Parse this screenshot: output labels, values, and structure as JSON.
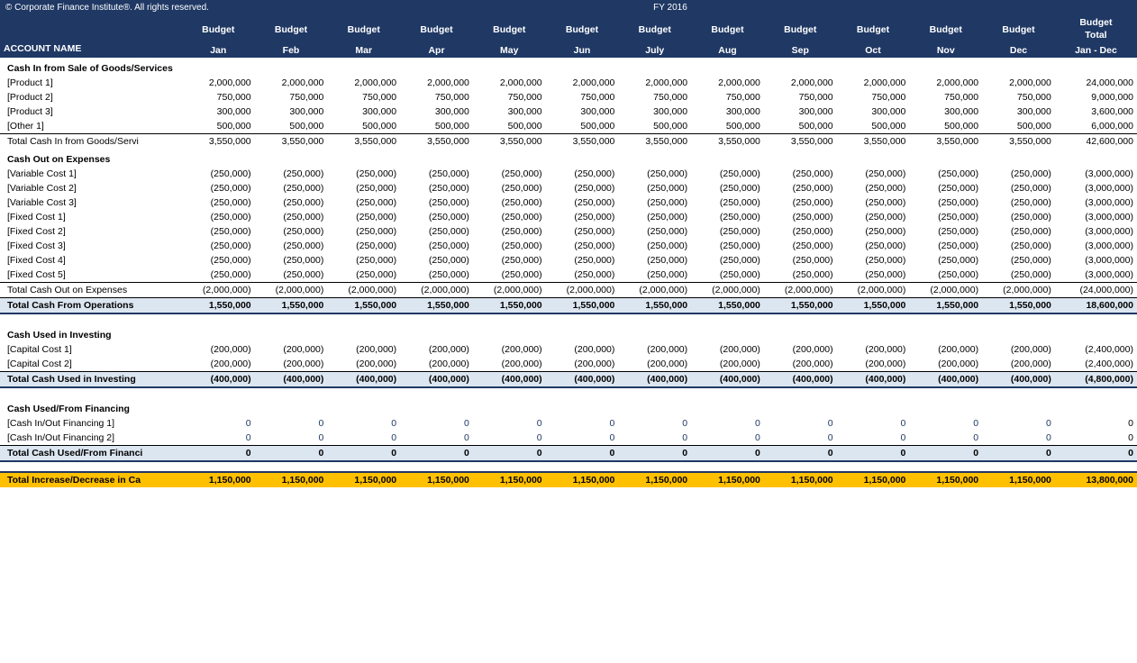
{
  "topBar": {
    "copyright": "© Corporate Finance Institute®. All rights reserved."
  },
  "fyHeader": "FY 2016",
  "columns": {
    "account": "ACCOUNT NAME",
    "months": [
      "Jan",
      "Feb",
      "Mar",
      "Apr",
      "May",
      "Jun",
      "July",
      "Aug",
      "Sep",
      "Oct",
      "Nov",
      "Dec"
    ],
    "budgetLabel": "Budget",
    "totalLabel": "Budget\nTotal",
    "totalSub": "Jan - Dec"
  },
  "sections": {
    "cashIn": {
      "header": "Cash In from Sale of Goods/Services",
      "rows": [
        {
          "name": "[Product 1]",
          "values": [
            "2,000,000",
            "2,000,000",
            "2,000,000",
            "2,000,000",
            "2,000,000",
            "2,000,000",
            "2,000,000",
            "2,000,000",
            "2,000,000",
            "2,000,000",
            "2,000,000",
            "2,000,000"
          ],
          "total": "24,000,000"
        },
        {
          "name": "[Product 2]",
          "values": [
            "750,000",
            "750,000",
            "750,000",
            "750,000",
            "750,000",
            "750,000",
            "750,000",
            "750,000",
            "750,000",
            "750,000",
            "750,000",
            "750,000"
          ],
          "total": "9,000,000"
        },
        {
          "name": "[Product 3]",
          "values": [
            "300,000",
            "300,000",
            "300,000",
            "300,000",
            "300,000",
            "300,000",
            "300,000",
            "300,000",
            "300,000",
            "300,000",
            "300,000",
            "300,000"
          ],
          "total": "3,600,000"
        },
        {
          "name": "[Other 1]",
          "values": [
            "500,000",
            "500,000",
            "500,000",
            "500,000",
            "500,000",
            "500,000",
            "500,000",
            "500,000",
            "500,000",
            "500,000",
            "500,000",
            "500,000"
          ],
          "total": "6,000,000"
        }
      ],
      "subtotal": {
        "name": "Total Cash In from Goods/Servi",
        "values": [
          "3,550,000",
          "3,550,000",
          "3,550,000",
          "3,550,000",
          "3,550,000",
          "3,550,000",
          "3,550,000",
          "3,550,000",
          "3,550,000",
          "3,550,000",
          "3,550,000",
          "3,550,000"
        ],
        "total": "42,600,000"
      }
    },
    "cashOut": {
      "header": "Cash Out on Expenses",
      "rows": [
        {
          "name": "[Variable Cost 1]",
          "values": [
            "(250,000)",
            "(250,000)",
            "(250,000)",
            "(250,000)",
            "(250,000)",
            "(250,000)",
            "(250,000)",
            "(250,000)",
            "(250,000)",
            "(250,000)",
            "(250,000)",
            "(250,000)"
          ],
          "total": "(3,000,000)"
        },
        {
          "name": "[Variable Cost 2]",
          "values": [
            "(250,000)",
            "(250,000)",
            "(250,000)",
            "(250,000)",
            "(250,000)",
            "(250,000)",
            "(250,000)",
            "(250,000)",
            "(250,000)",
            "(250,000)",
            "(250,000)",
            "(250,000)"
          ],
          "total": "(3,000,000)"
        },
        {
          "name": "[Variable Cost 3]",
          "values": [
            "(250,000)",
            "(250,000)",
            "(250,000)",
            "(250,000)",
            "(250,000)",
            "(250,000)",
            "(250,000)",
            "(250,000)",
            "(250,000)",
            "(250,000)",
            "(250,000)",
            "(250,000)"
          ],
          "total": "(3,000,000)"
        },
        {
          "name": "[Fixed Cost 1]",
          "values": [
            "(250,000)",
            "(250,000)",
            "(250,000)",
            "(250,000)",
            "(250,000)",
            "(250,000)",
            "(250,000)",
            "(250,000)",
            "(250,000)",
            "(250,000)",
            "(250,000)",
            "(250,000)"
          ],
          "total": "(3,000,000)"
        },
        {
          "name": "[Fixed Cost 2]",
          "values": [
            "(250,000)",
            "(250,000)",
            "(250,000)",
            "(250,000)",
            "(250,000)",
            "(250,000)",
            "(250,000)",
            "(250,000)",
            "(250,000)",
            "(250,000)",
            "(250,000)",
            "(250,000)"
          ],
          "total": "(3,000,000)"
        },
        {
          "name": "[Fixed Cost 3]",
          "values": [
            "(250,000)",
            "(250,000)",
            "(250,000)",
            "(250,000)",
            "(250,000)",
            "(250,000)",
            "(250,000)",
            "(250,000)",
            "(250,000)",
            "(250,000)",
            "(250,000)",
            "(250,000)"
          ],
          "total": "(3,000,000)"
        },
        {
          "name": "[Fixed Cost 4]",
          "values": [
            "(250,000)",
            "(250,000)",
            "(250,000)",
            "(250,000)",
            "(250,000)",
            "(250,000)",
            "(250,000)",
            "(250,000)",
            "(250,000)",
            "(250,000)",
            "(250,000)",
            "(250,000)"
          ],
          "total": "(3,000,000)"
        },
        {
          "name": "[Fixed Cost 5]",
          "values": [
            "(250,000)",
            "(250,000)",
            "(250,000)",
            "(250,000)",
            "(250,000)",
            "(250,000)",
            "(250,000)",
            "(250,000)",
            "(250,000)",
            "(250,000)",
            "(250,000)",
            "(250,000)"
          ],
          "total": "(3,000,000)"
        }
      ],
      "subtotal": {
        "name": "Total Cash Out on Expenses",
        "values": [
          "(2,000,000)",
          "(2,000,000)",
          "(2,000,000)",
          "(2,000,000)",
          "(2,000,000)",
          "(2,000,000)",
          "(2,000,000)",
          "(2,000,000)",
          "(2,000,000)",
          "(2,000,000)",
          "(2,000,000)",
          "(2,000,000)"
        ],
        "total": "(24,000,000)"
      }
    },
    "operations": {
      "total": {
        "name": "Total Cash From Operations",
        "values": [
          "1,550,000",
          "1,550,000",
          "1,550,000",
          "1,550,000",
          "1,550,000",
          "1,550,000",
          "1,550,000",
          "1,550,000",
          "1,550,000",
          "1,550,000",
          "1,550,000",
          "1,550,000"
        ],
        "total": "18,600,000"
      }
    },
    "investing": {
      "header": "Cash Used in Investing",
      "rows": [
        {
          "name": "[Capital Cost 1]",
          "values": [
            "(200,000)",
            "(200,000)",
            "(200,000)",
            "(200,000)",
            "(200,000)",
            "(200,000)",
            "(200,000)",
            "(200,000)",
            "(200,000)",
            "(200,000)",
            "(200,000)",
            "(200,000)"
          ],
          "total": "(2,400,000)"
        },
        {
          "name": "[Capital Cost 2]",
          "values": [
            "(200,000)",
            "(200,000)",
            "(200,000)",
            "(200,000)",
            "(200,000)",
            "(200,000)",
            "(200,000)",
            "(200,000)",
            "(200,000)",
            "(200,000)",
            "(200,000)",
            "(200,000)"
          ],
          "total": "(2,400,000)"
        }
      ],
      "total": {
        "name": "Total Cash Used in Investing",
        "values": [
          "(400,000)",
          "(400,000)",
          "(400,000)",
          "(400,000)",
          "(400,000)",
          "(400,000)",
          "(400,000)",
          "(400,000)",
          "(400,000)",
          "(400,000)",
          "(400,000)",
          "(400,000)"
        ],
        "total": "(4,800,000)"
      }
    },
    "financing": {
      "header": "Cash Used/From Financing",
      "rows": [
        {
          "name": "[Cash In/Out Financing 1]",
          "values": [
            "0",
            "0",
            "0",
            "0",
            "0",
            "0",
            "0",
            "0",
            "0",
            "0",
            "0",
            "0"
          ],
          "total": "0"
        },
        {
          "name": "[Cash In/Out Financing 2]",
          "values": [
            "0",
            "0",
            "0",
            "0",
            "0",
            "0",
            "0",
            "0",
            "0",
            "0",
            "0",
            "0"
          ],
          "total": "0"
        }
      ],
      "total": {
        "name": "Total Cash Used/From Financi",
        "values": [
          "0",
          "0",
          "0",
          "0",
          "0",
          "0",
          "0",
          "0",
          "0",
          "0",
          "0",
          "0"
        ],
        "total": "0"
      }
    },
    "grandTotal": {
      "name": "Total Increase/Decrease in Ca",
      "values": [
        "1,150,000",
        "1,150,000",
        "1,150,000",
        "1,150,000",
        "1,150,000",
        "1,150,000",
        "1,150,000",
        "1,150,000",
        "1,150,000",
        "1,150,000",
        "1,150,000",
        "1,150,000"
      ],
      "total": "13,800,000"
    }
  }
}
